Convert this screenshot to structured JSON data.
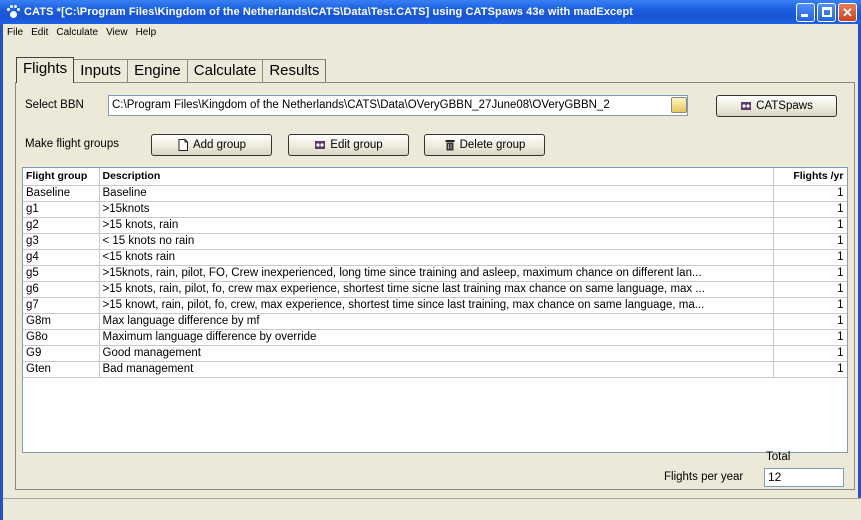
{
  "window": {
    "title": "CATS *[C:\\Program Files\\Kingdom of the Netherlands\\CATS\\Data\\Test.CATS]  using CATSpaws 43e with madExcept"
  },
  "menu": [
    "File",
    "Edit",
    "Calculate",
    "View",
    "Help"
  ],
  "tabs": [
    "Flights",
    "Inputs",
    "Engine",
    "Calculate",
    "Results"
  ],
  "active_tab": "Flights",
  "bbn": {
    "label": "Select BBN",
    "path": "C:\\Program Files\\Kingdom of the Netherlands\\CATS\\Data\\OVeryGBBN_27June08\\OVeryGBBN_2",
    "catspaws_label": "CATSpaws"
  },
  "groups": {
    "label": "Make flight groups",
    "add_label": "Add group",
    "edit_label": "Edit group",
    "delete_label": "Delete group"
  },
  "table": {
    "headers": [
      "Flight group",
      "Description",
      "Flights /yr"
    ],
    "rows": [
      {
        "group": "Baseline",
        "description": "Baseline",
        "flights": "1"
      },
      {
        "group": "g1",
        "description": ">15knots",
        "flights": "1"
      },
      {
        "group": "g2",
        "description": ">15 knots, rain",
        "flights": "1"
      },
      {
        "group": "g3",
        "description": "< 15 knots no rain",
        "flights": "1"
      },
      {
        "group": "g4",
        "description": "<15 knots rain",
        "flights": "1"
      },
      {
        "group": "g5",
        "description": ">15knots, rain, pilot, FO, Crew  inexperienced, long time since training and asleep, maximum chance on different lan...",
        "flights": "1"
      },
      {
        "group": "g6",
        "description": ">15 knots, rain, pilot, fo, crew max experience, shortest time sicne last training max chance on same language, max ...",
        "flights": "1"
      },
      {
        "group": "g7",
        "description": ">15 knowt, rain, pilot, fo, crew, max experience, shortest time since last training, max chance on same language, ma...",
        "flights": "1"
      },
      {
        "group": "G8m",
        "description": "Max language difference by mf",
        "flights": "1"
      },
      {
        "group": "G8o",
        "description": "Maximum language difference by override",
        "flights": "1"
      },
      {
        "group": "G9",
        "description": "Good management",
        "flights": "1"
      },
      {
        "group": "Gten",
        "description": "Bad management",
        "flights": "1"
      }
    ]
  },
  "totals": {
    "total_label": "Total",
    "flights_per_year_label": "Flights per year",
    "flights_per_year_value": "12"
  },
  "colors": {
    "titlebar": "#1a5fe0",
    "window_bg": "#ece9d8",
    "close_button": "#c9431f"
  }
}
